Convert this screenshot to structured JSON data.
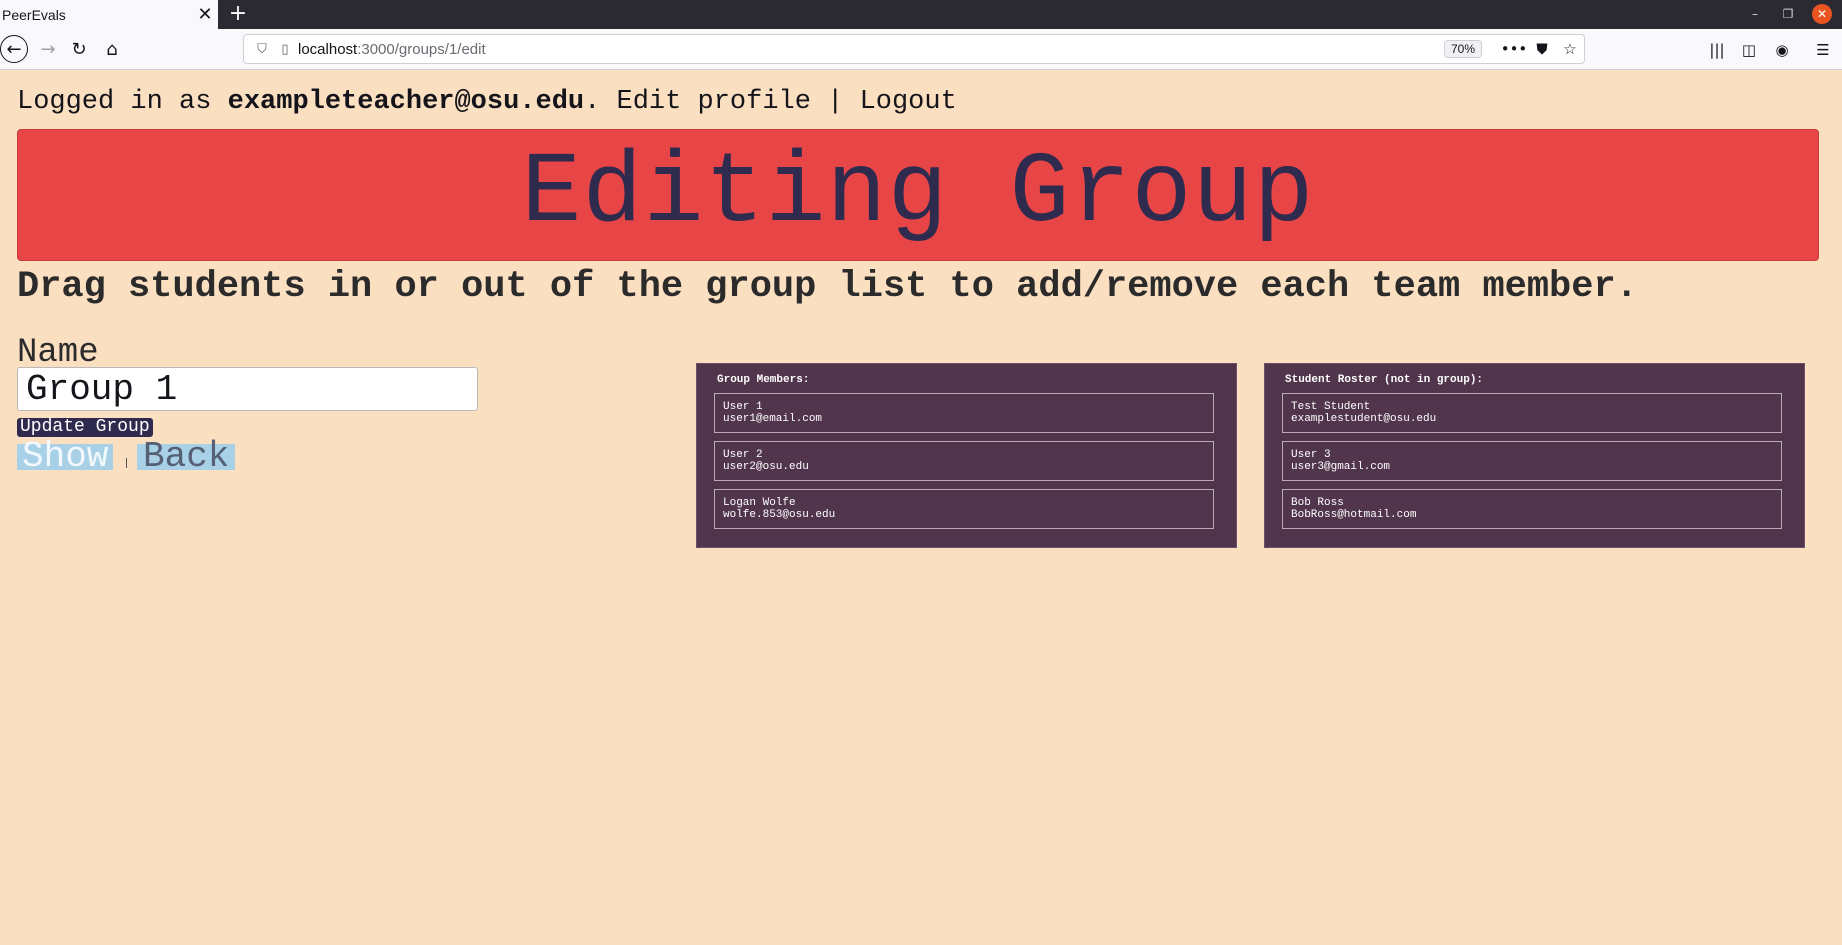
{
  "browser": {
    "tab_title": "PeerEvals",
    "url_host": "localhost",
    "url_path": ":3000/groups/1/edit",
    "zoom": "70%"
  },
  "header": {
    "login_prefix": "Logged in as",
    "user_email": "exampleteacher@osu.edu",
    "period": ".",
    "edit_profile": "Edit profile",
    "separator": "|",
    "logout": "Logout"
  },
  "banner": {
    "title": "Editing Group"
  },
  "instructions": "Drag students in or out of the group list to add/remove each team member.",
  "form": {
    "name_label": "Name",
    "name_value": "Group 1",
    "submit_label": "Update Group",
    "show_label": "Show",
    "back_label": "Back"
  },
  "group_members": {
    "title": "Group Members:",
    "items": [
      {
        "name": "User 1",
        "email": "user1@email.com"
      },
      {
        "name": "User 2",
        "email": "user2@osu.edu"
      },
      {
        "name": "Logan Wolfe",
        "email": "wolfe.853@osu.edu"
      }
    ]
  },
  "roster": {
    "title": "Student Roster (not in group):",
    "items": [
      {
        "name": "Test Student",
        "email": "examplestudent@osu.edu"
      },
      {
        "name": "User 3",
        "email": "user3@gmail.com"
      },
      {
        "name": "Bob Ross",
        "email": "BobRoss@hotmail.com"
      }
    ]
  },
  "colors": {
    "page_bg": "#fbdfc1",
    "banner_bg": "#e84546",
    "banner_text": "#2f2b4e",
    "panel_bg": "#51354c",
    "link_bg": "#a8d1e8"
  }
}
